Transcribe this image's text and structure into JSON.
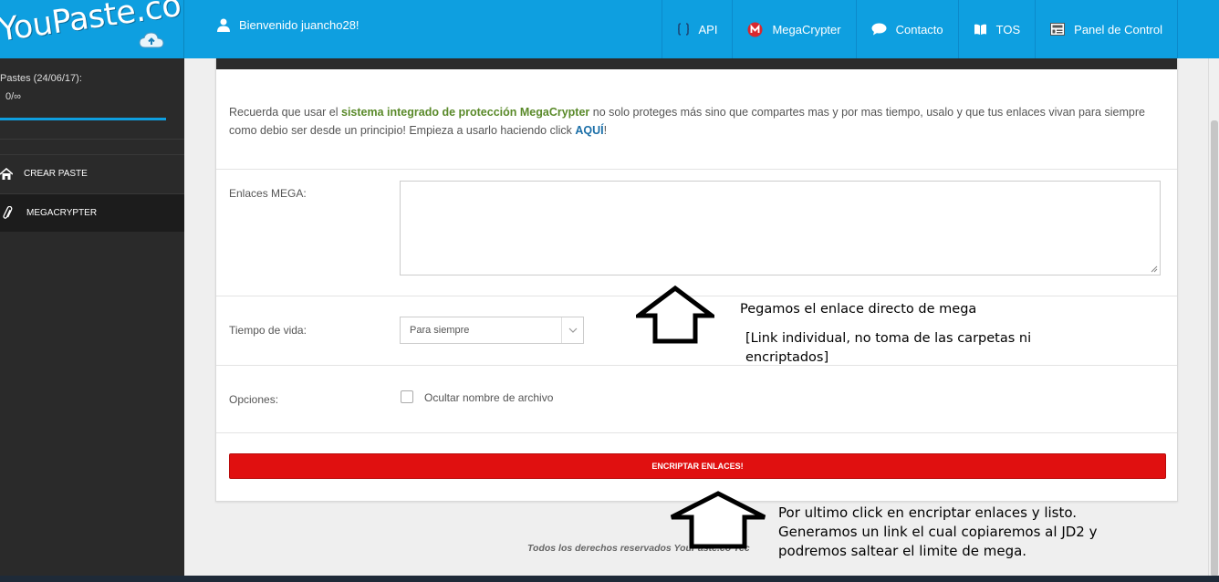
{
  "brand": {
    "logo_text": "YouPaste.co"
  },
  "header": {
    "welcome": "Bienvenido juancho28!",
    "nav": [
      {
        "label": "API",
        "icon": "api-icon"
      },
      {
        "label": "MegaCrypter",
        "icon": "mega-icon"
      },
      {
        "label": "Contacto",
        "icon": "chat-icon"
      },
      {
        "label": "TOS",
        "icon": "book-icon"
      },
      {
        "label": "Panel de Control",
        "icon": "dashboard-icon"
      }
    ]
  },
  "sidebar": {
    "stat_label": "Pastes (24/06/17):",
    "stat_value": "0/∞",
    "progress": 1.0,
    "items": [
      {
        "label": "CREAR PASTE",
        "icon": "home-icon"
      },
      {
        "label": "MEGACRYPTER",
        "icon": "paperclip-icon"
      }
    ]
  },
  "form": {
    "notice_prefix": "Recuerda que usar el ",
    "notice_highlight": "sistema integrado de protección MegaCrypter",
    "notice_middle": " no solo proteges más sino que compartes mas y por mas tiempo, usalo y que tus enlaces vivan para siempre como debio ser desde un principio! Empieza a usarlo haciendo click ",
    "notice_link": "AQUÍ",
    "notice_suffix": "!",
    "links_label": "Enlaces MEGA:",
    "links_value": "",
    "lifetime_label": "Tiempo de vida:",
    "lifetime_value": "Para siempre",
    "options_label": "Opciones:",
    "hide_filename_label": "Ocultar nombre de archivo",
    "hide_filename_checked": false,
    "submit_label": "ENCRIPTAR ENLACES!"
  },
  "footer": {
    "text": "Todos los derechos reservados YouPaste.co Tec"
  },
  "annotations": {
    "a1": "Pegamos el enlace directo de mega",
    "a2_line1": "[Link individual, no toma de las carpetas ni",
    "a2_line2": "encriptados]",
    "a3_line1": "Por ultimo click en encriptar enlaces y listo.",
    "a3_line2": "Generamos un link el cual copiaremos al JD2 y",
    "a3_line3": "podremos saltear el limite de mega."
  },
  "colors": {
    "primary": "#0e9fe0",
    "sidebar": "#2a2a2a",
    "danger": "#e01010",
    "highlight": "#5a8a2a"
  }
}
